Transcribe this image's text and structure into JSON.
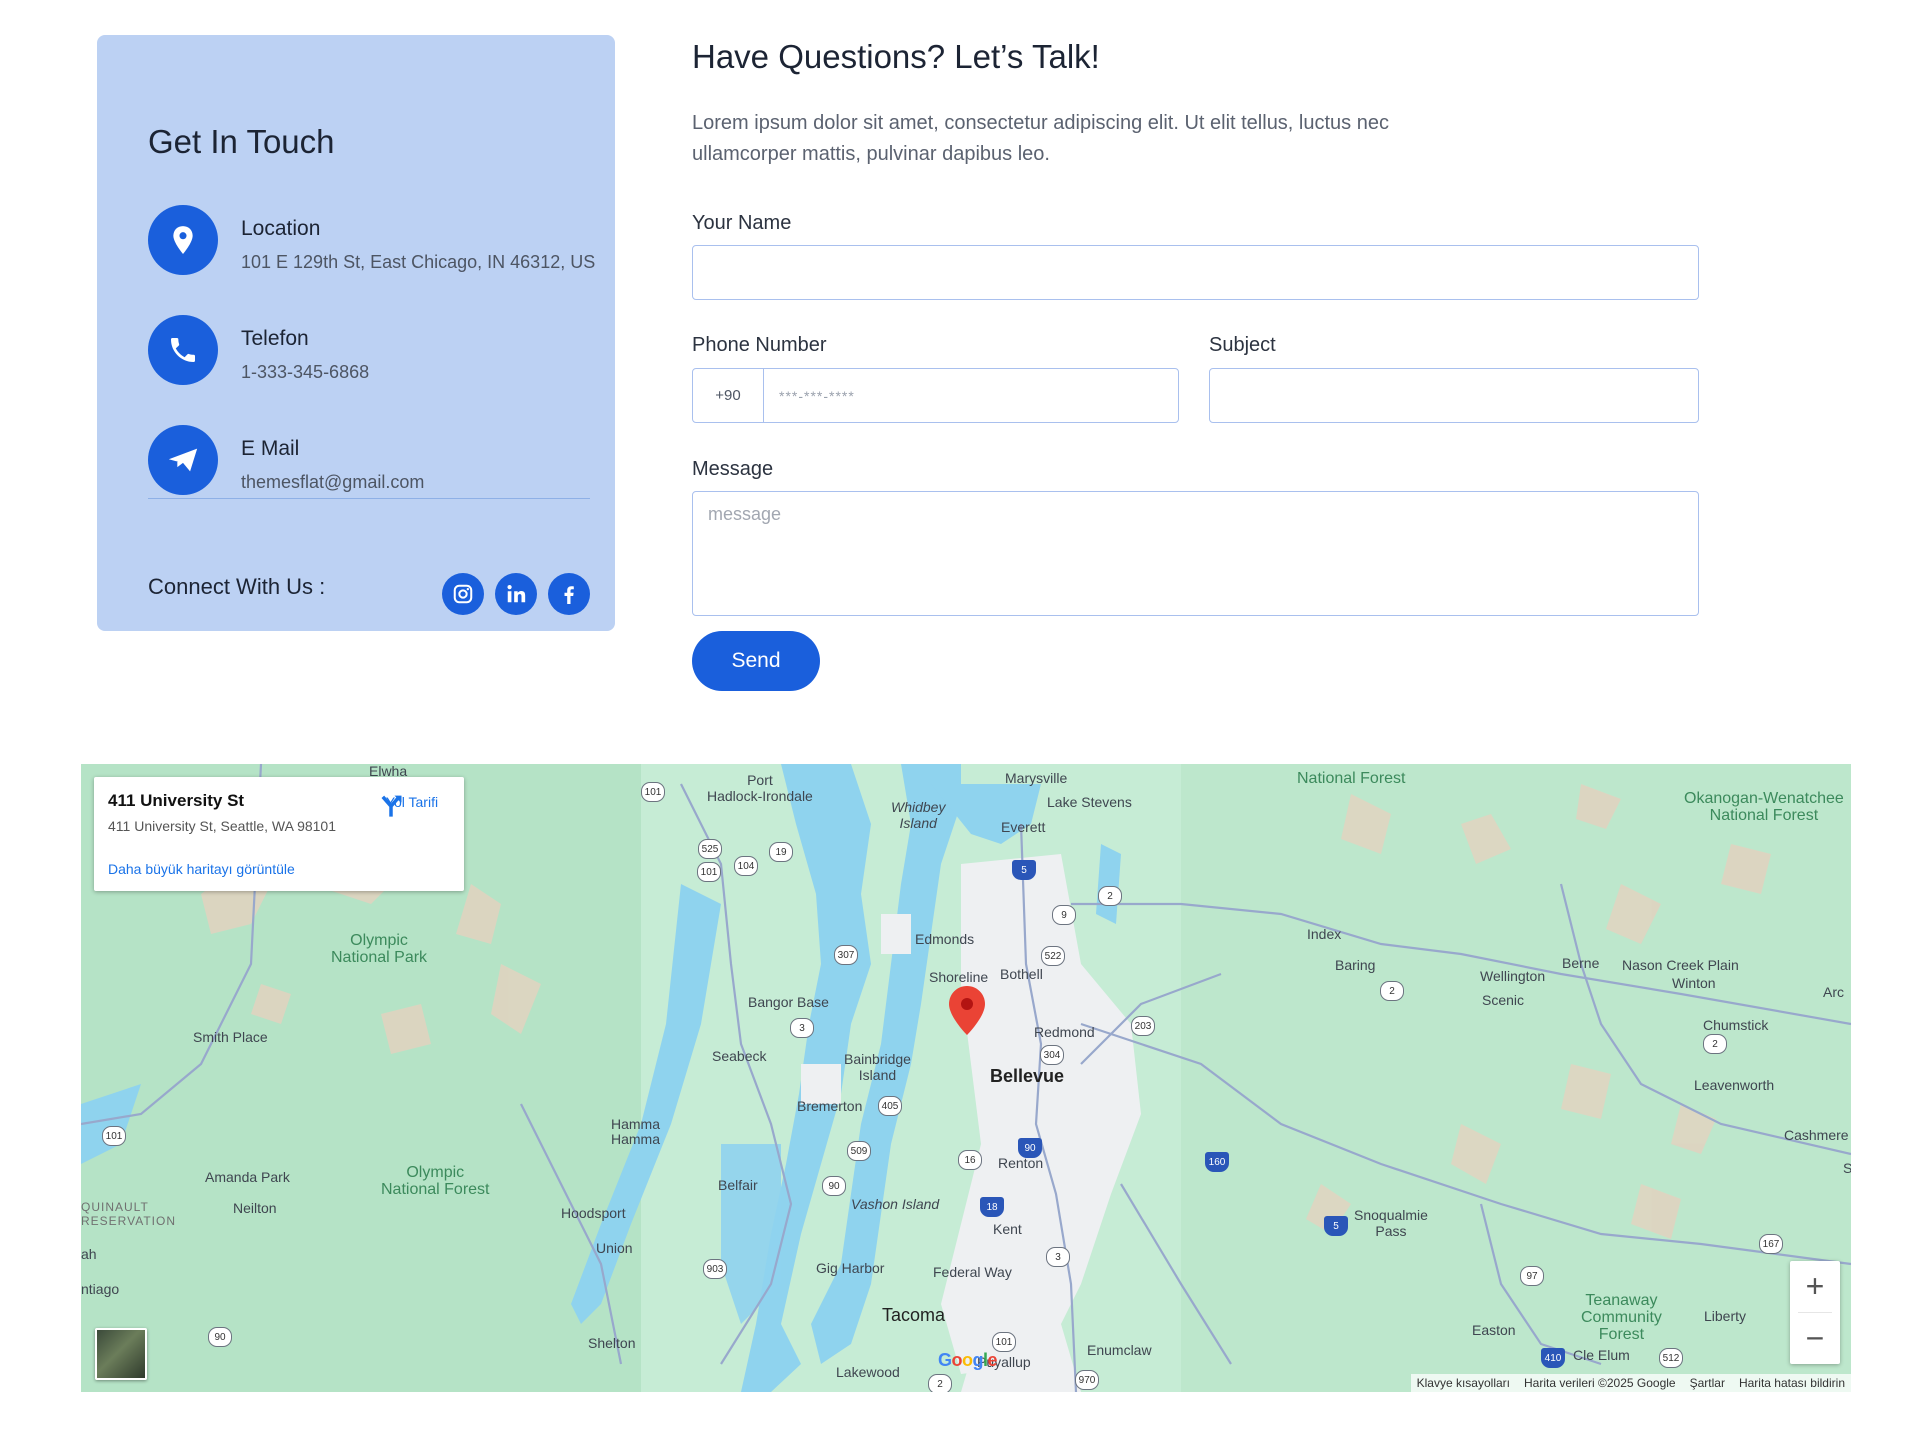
{
  "contact_card": {
    "title": "Get In Touch",
    "location": {
      "label": "Location",
      "value": "101 E 129th St, East Chicago, IN 46312, US"
    },
    "phone": {
      "label": "Telefon",
      "value": "1-333-345-6868"
    },
    "email": {
      "label": "E Mail",
      "value": "themesflat@gmail.com"
    },
    "connect_label": "Connect With Us :",
    "socials": [
      "instagram-icon",
      "linkedin-icon",
      "facebook-icon"
    ],
    "accent": "#1a5fdc",
    "background": "#bcd1f3"
  },
  "form": {
    "title": "Have Questions? Let’s Talk!",
    "description": "Lorem ipsum dolor sit amet, consectetur adipiscing elit. Ut elit tellus, luctus nec ullamcorper mattis, pulvinar dapibus leo.",
    "name_label": "Your Name",
    "name_value": "",
    "phone_label": "Phone Number",
    "phone_code": "+90",
    "phone_placeholder": "***-***-****",
    "subject_label": "Subject",
    "subject_value": "",
    "message_label": "Message",
    "message_placeholder": "message",
    "send_label": "Send"
  },
  "map": {
    "infobox": {
      "title": "411 University St",
      "address": "411 University St, Seattle, WA 98101",
      "directions_label": "Yol Tarifi",
      "larger_map_link": "Daha büyük haritayı görüntüle"
    },
    "places": {
      "elwha": "Elwha",
      "port_hadlock": "Port\nHadlock-Irondale",
      "whidbey": "Whidbey\nIsland",
      "marysville": "Marysville",
      "lake_stevens": "Lake Stevens",
      "everett": "Everett",
      "nf_top": "National Forest",
      "okanogan": "Okanogan-Wenatchee\nNational Forest",
      "olympic_np": "Olympic\nNational Park",
      "edmonds": "Edmonds",
      "shoreline": "Shoreline",
      "bothell": "Bothell",
      "index": "Index",
      "baring": "Baring",
      "berne": "Berne",
      "nason": "Nason Creek Plain",
      "wellington": "Wellington",
      "winton": "Winton",
      "scenic": "Scenic",
      "bangor": "Bangor Base",
      "smith_place": "Smith Place",
      "redmond": "Redmond",
      "chumstick": "Chumstick",
      "seabeck": "Seabeck",
      "bainbridge": "Bainbridge\nIsland",
      "bellevue": "Bellevue",
      "leavenworth": "Leavenworth",
      "bremerton": "Bremerton",
      "hamma": "Hamma\nHamma",
      "cashmere": "Cashmere",
      "renton": "Renton",
      "olympic_nf": "Olympic\nNational Forest",
      "amanda_park": "Amanda Park",
      "quinault": "QUINAULT\nRESERVATION",
      "neilton": "Neilton",
      "belfair": "Belfair",
      "vashon": "Vashon Island",
      "hoodsport": "Hoodsport",
      "kent": "Kent",
      "snoqualmie": "Snoqualmie\nPass",
      "union": "Union",
      "gig_harbor": "Gig Harbor",
      "federal_way": "Federal Way",
      "teanaway": "Teanaway\nCommunity\nForest",
      "tacoma": "Tacoma",
      "liberty": "Liberty",
      "easton": "Easton",
      "shelton": "Shelton",
      "enumclaw": "Enumclaw",
      "lakewood": "Lakewood",
      "puyallup": "Puyallup",
      "cle_elum": "Cle Elum",
      "ah": "ah",
      "ntiago": "ntiago",
      "arc": "Arc",
      "s_edge": "S"
    },
    "routes": [
      "101",
      "101",
      "525",
      "19",
      "101",
      "104",
      "5",
      "9",
      "2",
      "307",
      "522",
      "3",
      "203",
      "304",
      "405",
      "90",
      "160",
      "509",
      "16",
      "90",
      "5",
      "18",
      "3",
      "903",
      "97",
      "167",
      "101",
      "90",
      "410",
      "970",
      "512",
      "2",
      "2",
      "2"
    ],
    "google_logo": "Google",
    "attribution": [
      "Klavye kısayolları",
      "Harita verileri ©2025 Google",
      "Şartlar",
      "Harita hatası bildirin"
    ],
    "colors": {
      "land": "#c6ecd5",
      "water": "#8fd3ee",
      "urban": "#eef0f2",
      "mountain": "#e2d3c0",
      "pin": "#ea4335"
    }
  }
}
